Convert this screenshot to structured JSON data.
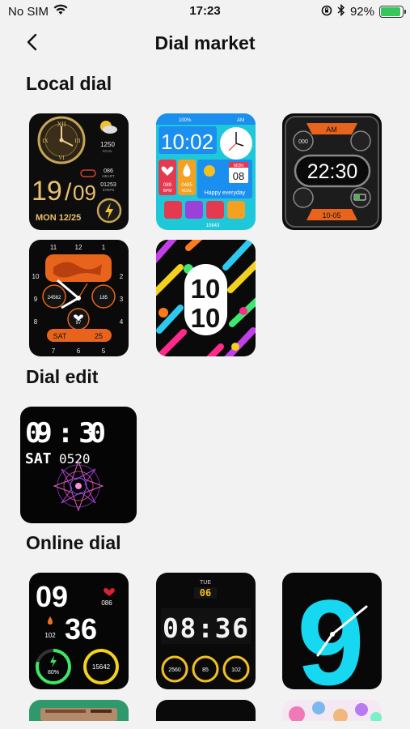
{
  "status_bar": {
    "carrier": "No SIM",
    "time": "17:23",
    "battery_pct": "92%",
    "battery_level": 0.92
  },
  "nav": {
    "title": "Dial market"
  },
  "sections": {
    "local": "Local dial",
    "edit": "Dial edit",
    "online": "Online dial"
  },
  "local_dials": [
    {
      "day": "19",
      "month": "09",
      "date_line": "MON 12/25",
      "stat1": "1250",
      "stat1_unit": "KCAL",
      "stat2": "086",
      "stat2_unit": "HEART",
      "stat3": "01253",
      "stat3_unit": "STEPS"
    },
    {
      "battery": "100%",
      "time": "10:02",
      "ampm": "AM",
      "cal_month": "MON",
      "cal_day": "08",
      "stat1": "089",
      "stat1_unit": "BPM",
      "stat2": "0485",
      "stat2_unit": "KCAL",
      "greeting": "Happy everyday",
      "steps": "10643"
    },
    {
      "time": "22:30",
      "ampm": "AM",
      "stat": "000",
      "date": "10-05"
    },
    {
      "steps": "24562",
      "kcal": "185",
      "heart": "97",
      "day": "SAT",
      "date": "25",
      "hour_marks": [
        "12",
        "1",
        "2",
        "3",
        "4",
        "5",
        "6",
        "7",
        "8",
        "9",
        "10",
        "11"
      ]
    },
    {
      "hour": "10",
      "minute": "10"
    }
  ],
  "edit_dial": {
    "time": "09 : 30",
    "day": "SAT",
    "date": "0520"
  },
  "online_dials": [
    {
      "hour": "09",
      "minute": "36",
      "heart": "086",
      "kcal": "102",
      "progress": "80%",
      "steps": "15642"
    },
    {
      "day": "TUE",
      "date": "06",
      "time": "08:36",
      "stat1": "2560",
      "stat2": "85",
      "stat3": "102"
    },
    {
      "numeral": "9"
    }
  ]
}
